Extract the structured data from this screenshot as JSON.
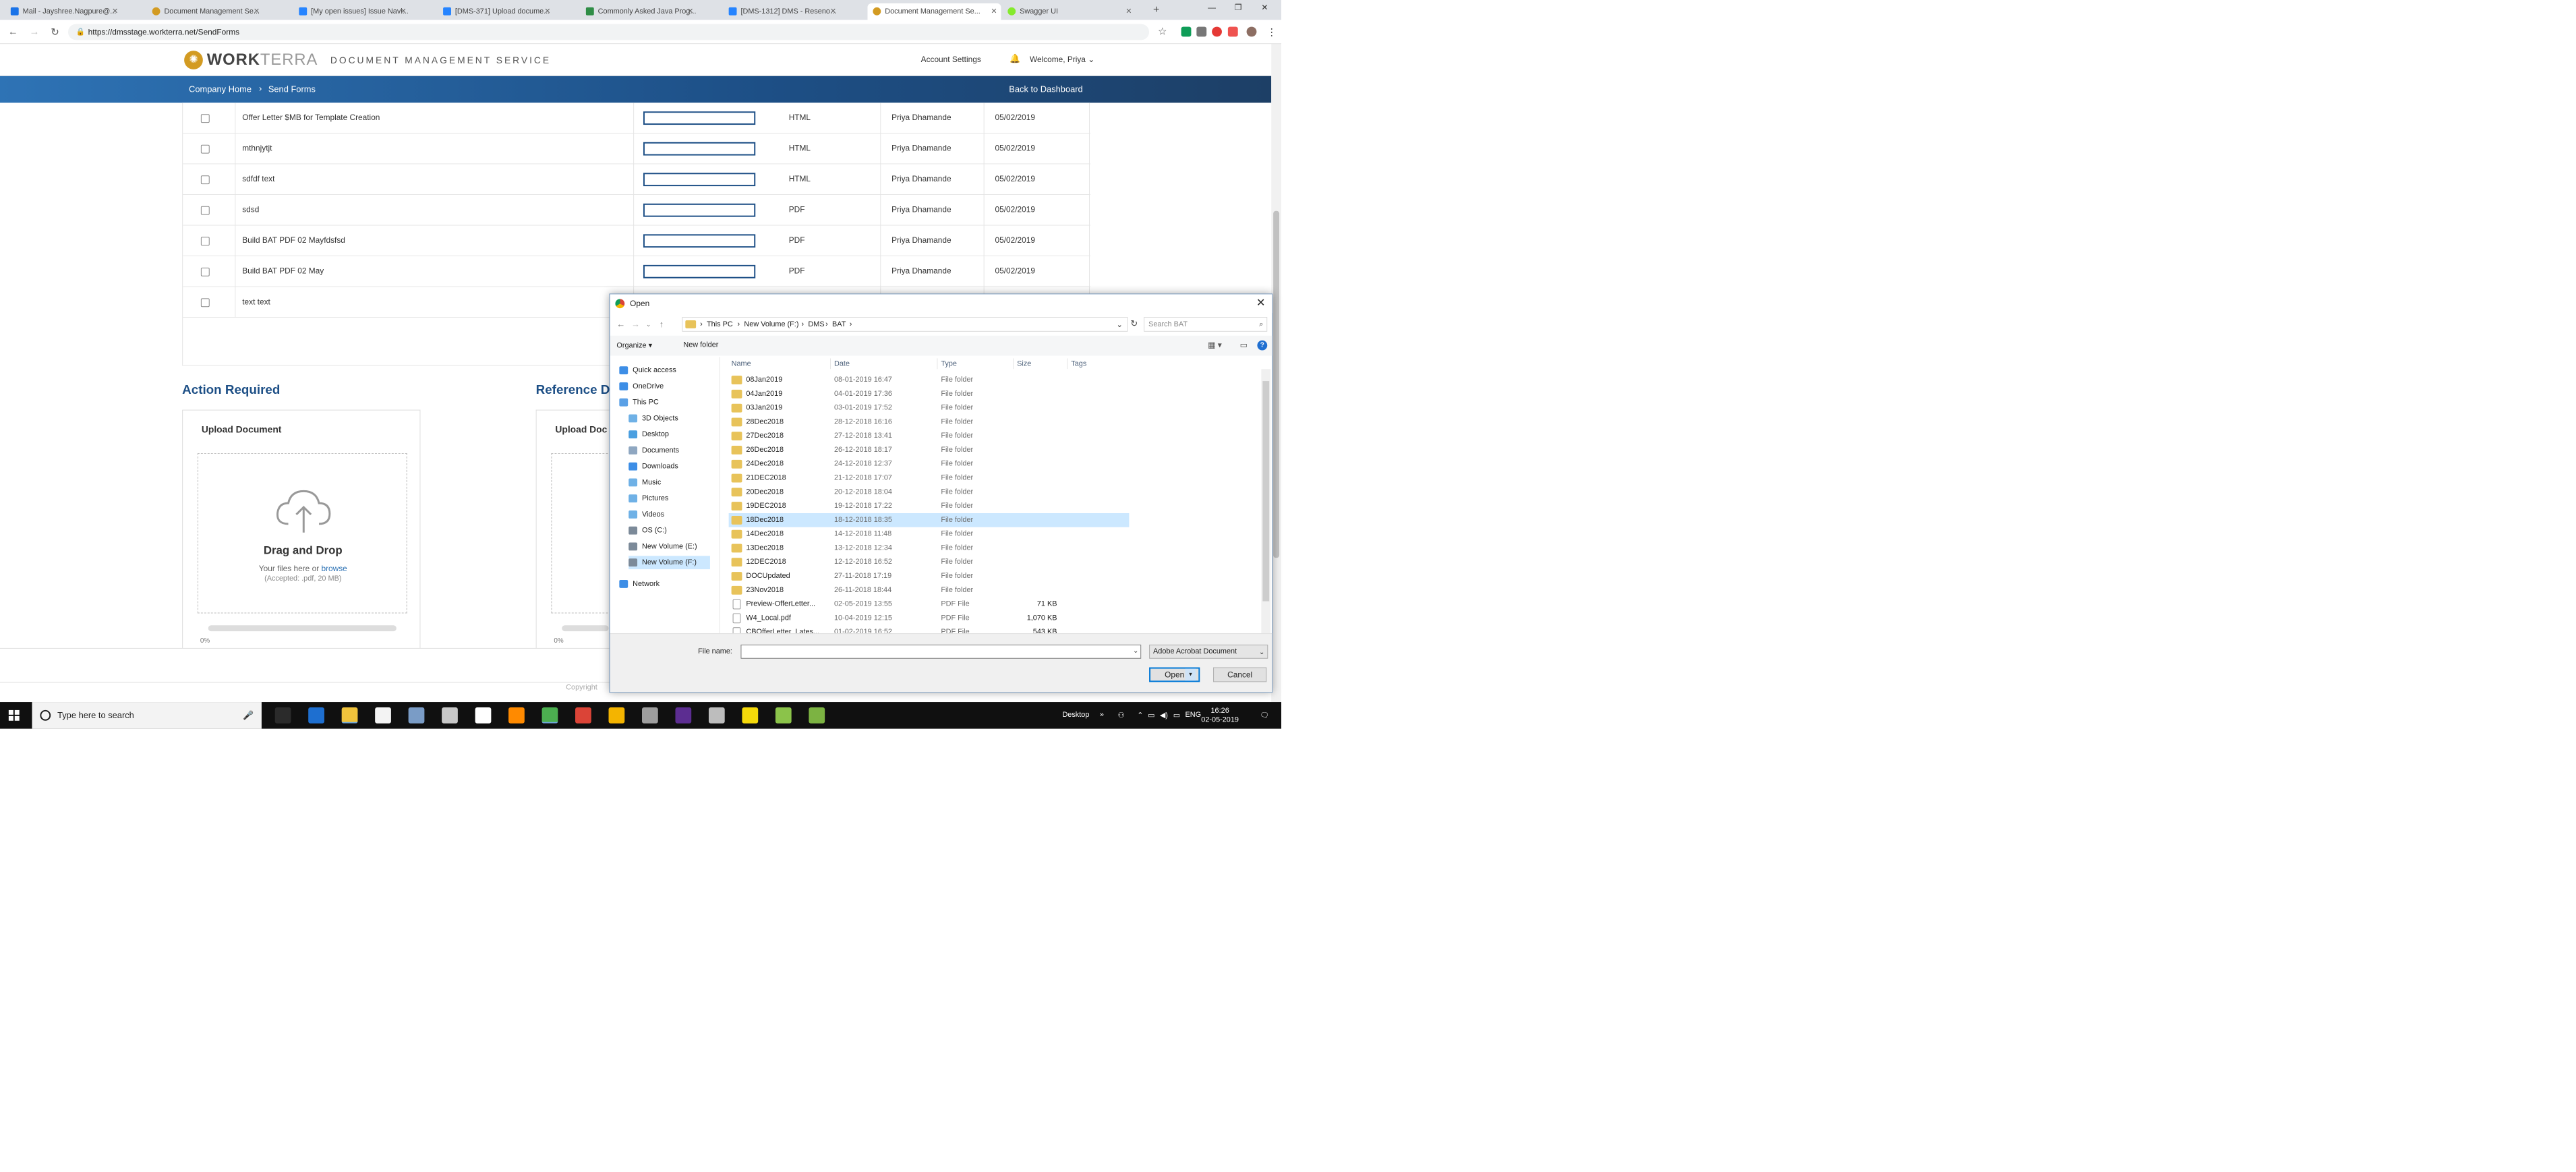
{
  "browser": {
    "tabs": [
      {
        "label": "Mail - Jayshree.Nagpure@...",
        "color": "#1a73e8"
      },
      {
        "label": "Document Management Se...",
        "color": "#d39b22"
      },
      {
        "label": "[My open issues] Issue Navi...",
        "color": "#2684ff"
      },
      {
        "label": "[DMS-371] Upload docume...",
        "color": "#2684ff"
      },
      {
        "label": "Commonly Asked Java Prog...",
        "color": "#2f8d46"
      },
      {
        "label": "[DMS-1312] DMS - Reseno...",
        "color": "#2684ff"
      },
      {
        "label": "Document Management Se...",
        "color": "#d39b22"
      },
      {
        "label": "Swagger UI",
        "color": "#85ea2d"
      }
    ],
    "url": "https://dmsstage.workterra.net/SendForms"
  },
  "app": {
    "brand_bold": "WORK",
    "brand_light": "TERRA",
    "service": "DOCUMENT MANAGEMENT SERVICE",
    "account_settings": "Account Settings",
    "welcome": "Welcome, Priya",
    "breadcrumb": [
      "Company Home",
      "Send Forms"
    ],
    "back": "Back to Dashboard"
  },
  "forms_table": {
    "rows": [
      {
        "name": "Offer Letter $MB for Template Creation",
        "type": "HTML",
        "owner": "Priya Dhamande",
        "date": "05/02/2019"
      },
      {
        "name": "mthnjytjt",
        "type": "HTML",
        "owner": "Priya Dhamande",
        "date": "05/02/2019"
      },
      {
        "name": "sdfdf text",
        "type": "HTML",
        "owner": "Priya Dhamande",
        "date": "05/02/2019"
      },
      {
        "name": "sdsd",
        "type": "PDF",
        "owner": "Priya Dhamande",
        "date": "05/02/2019"
      },
      {
        "name": "Build BAT PDF 02 Mayfdsfsd",
        "type": "PDF",
        "owner": "Priya Dhamande",
        "date": "05/02/2019"
      },
      {
        "name": "Build BAT PDF 02 May",
        "type": "PDF",
        "owner": "Priya Dhamande",
        "date": "05/02/2019"
      },
      {
        "name": "text text",
        "type": "",
        "owner": "",
        "date": ""
      }
    ]
  },
  "sections": {
    "action_required": "Action Required",
    "reference": "Reference D",
    "upload_title": "Upload Document",
    "upload_title_partial": "Upload Doc",
    "drag_drop": "Drag and Drop",
    "your_files": "Your files here or",
    "browse": "browse",
    "accepted": "(Accepted: .pdf, 20 MB)",
    "progress_label": "0%",
    "progress_label_partial": "0%",
    "progress_fraction": 0,
    "copyright": "Copyright"
  },
  "dialog": {
    "title": "Open",
    "path": [
      "This PC",
      "New Volume (F:)",
      "DMS",
      "BAT"
    ],
    "search_placeholder": "Search BAT",
    "organize": "Organize",
    "new_folder": "New folder",
    "nav": [
      {
        "label": "Quick access",
        "color": "#3d8ee6"
      },
      {
        "label": "OneDrive",
        "color": "#3d8ee6"
      },
      {
        "label": "This PC",
        "color": "#5aa0e6"
      },
      {
        "label": "3D Objects",
        "color": "#6fb1e6"
      },
      {
        "label": "Desktop",
        "color": "#4b9fe0"
      },
      {
        "label": "Documents",
        "color": "#8fa7c1"
      },
      {
        "label": "Downloads",
        "color": "#3d8ee6"
      },
      {
        "label": "Music",
        "color": "#6fb1e6"
      },
      {
        "label": "Pictures",
        "color": "#6fb1e6"
      },
      {
        "label": "Videos",
        "color": "#6fb1e6"
      },
      {
        "label": "OS (C:)",
        "color": "#7c8a99"
      },
      {
        "label": "New Volume (E:)",
        "color": "#7c8a99"
      },
      {
        "label": "New Volume (F:)",
        "color": "#7c8a99"
      },
      {
        "label": "Network",
        "color": "#3d8ee6"
      }
    ],
    "columns": [
      "Name",
      "Date",
      "Type",
      "Size",
      "Tags"
    ],
    "files": [
      {
        "name": "08Jan2019",
        "date": "08-01-2019 16:47",
        "type": "File folder",
        "size": ""
      },
      {
        "name": "04Jan2019",
        "date": "04-01-2019 17:36",
        "type": "File folder",
        "size": ""
      },
      {
        "name": "03Jan2019",
        "date": "03-01-2019 17:52",
        "type": "File folder",
        "size": ""
      },
      {
        "name": "28Dec2018",
        "date": "28-12-2018 16:16",
        "type": "File folder",
        "size": ""
      },
      {
        "name": "27Dec2018",
        "date": "27-12-2018 13:41",
        "type": "File folder",
        "size": ""
      },
      {
        "name": "26Dec2018",
        "date": "26-12-2018 18:17",
        "type": "File folder",
        "size": ""
      },
      {
        "name": "24Dec2018",
        "date": "24-12-2018 12:37",
        "type": "File folder",
        "size": ""
      },
      {
        "name": "21DEC2018",
        "date": "21-12-2018 17:07",
        "type": "File folder",
        "size": ""
      },
      {
        "name": "20Dec2018",
        "date": "20-12-2018 18:04",
        "type": "File folder",
        "size": ""
      },
      {
        "name": "19DEC2018",
        "date": "19-12-2018 17:22",
        "type": "File folder",
        "size": ""
      },
      {
        "name": "18Dec2018",
        "date": "18-12-2018 18:35",
        "type": "File folder",
        "size": ""
      },
      {
        "name": "14Dec2018",
        "date": "14-12-2018 11:48",
        "type": "File folder",
        "size": ""
      },
      {
        "name": "13Dec2018",
        "date": "13-12-2018 12:34",
        "type": "File folder",
        "size": ""
      },
      {
        "name": "12DEC2018",
        "date": "12-12-2018 16:52",
        "type": "File folder",
        "size": ""
      },
      {
        "name": "DOCUpdated",
        "date": "27-11-2018 17:19",
        "type": "File folder",
        "size": ""
      },
      {
        "name": "23Nov2018",
        "date": "26-11-2018 18:44",
        "type": "File folder",
        "size": ""
      },
      {
        "name": "Preview-OfferLetter...",
        "date": "02-05-2019 13:55",
        "type": "PDF File",
        "size": "71 KB"
      },
      {
        "name": "W4_Local.pdf",
        "date": "10-04-2019 12:15",
        "type": "PDF File",
        "size": "1,070 KB"
      },
      {
        "name": "CBOfferLetter_Lates...",
        "date": "01-02-2019 16:52",
        "type": "PDF File",
        "size": "543 KB"
      }
    ],
    "file_name_label": "File name:",
    "file_name_value": "",
    "file_type": "Adobe Acrobat Document",
    "open": "Open",
    "cancel": "Cancel"
  },
  "taskbar": {
    "search": "Type here to search",
    "desktop": "Desktop",
    "lang": "ENG",
    "time": "16:26",
    "date": "02-05-2019",
    "icons": [
      {
        "name": "task-view-icon",
        "color": "#2b2b2b"
      },
      {
        "name": "edge-icon",
        "color": "#1e6fd0"
      },
      {
        "name": "file-explorer-icon",
        "color": "#f0c33c"
      },
      {
        "name": "store-icon",
        "color": "#f3f3f3"
      },
      {
        "name": "ssms-icon",
        "color": "#7a9cc6"
      },
      {
        "name": "toolbox-icon",
        "color": "#c7c7c7"
      },
      {
        "name": "mail-icon",
        "color": "#ffffff"
      },
      {
        "name": "firefox-icon",
        "color": "#ff8a00"
      },
      {
        "name": "chrome-icon",
        "color": "#4caf50"
      },
      {
        "name": "chrome-alt-icon",
        "color": "#db4437"
      },
      {
        "name": "chrome-beta-icon",
        "color": "#f4b400"
      },
      {
        "name": "calculator-icon",
        "color": "#9e9e9e"
      },
      {
        "name": "visual-studio-icon",
        "color": "#5c2d91"
      },
      {
        "name": "settings-icon",
        "color": "#bdbdbd"
      },
      {
        "name": "sticky-notes-icon",
        "color": "#f5d90a"
      },
      {
        "name": "notepad-plus-icon",
        "color": "#8bc34a"
      },
      {
        "name": "app-icon",
        "color": "#7cb342"
      }
    ]
  }
}
